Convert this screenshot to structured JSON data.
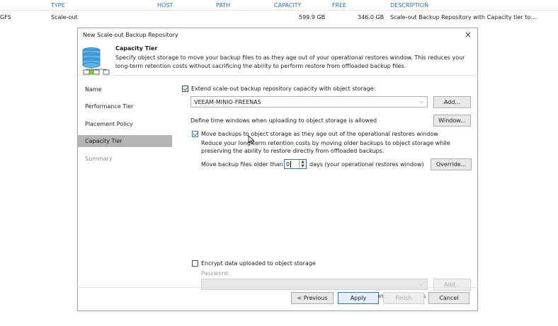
{
  "background_table": {
    "columns": [
      "TYPE",
      "HOST",
      "PATH",
      "CAPACITY",
      "FREE",
      "DESCRIPTION"
    ],
    "row": {
      "name": "GFS",
      "type": "Scale-out",
      "host": "",
      "path": "",
      "capacity": "599.9 GB",
      "free": "346.0 GB",
      "description": "Scale-out Backup Repository with Capacity tier to..."
    }
  },
  "dialog": {
    "title": "New Scale-out Backup Repository",
    "close_label": "×",
    "header": {
      "icon": "storage-repository-icon",
      "title": "Capacity Tier",
      "description": "Specify object storage to move your backup files to as they age out of your operational restores window. This reduces your long-term retention costs without sacrificing the ability to perform restore from offloaded backup files."
    },
    "steps": [
      {
        "label": "Name",
        "state": "normal"
      },
      {
        "label": "Performance Tier",
        "state": "normal"
      },
      {
        "label": "Placement Policy",
        "state": "normal"
      },
      {
        "label": "Capacity Tier",
        "state": "active"
      },
      {
        "label": "Summary",
        "state": "disabled"
      }
    ],
    "content": {
      "extend_label": "Extend scale-out backup repository capacity with object storage:",
      "extend_checked": true,
      "object_storage_value": "VEEAM-MINIO-FREENAS",
      "add_label": "Add...",
      "time_windows_label": "Define time windows when uploading to object storage is allowed",
      "window_label": "Window...",
      "move_label": "Move backups to object storage as they age out of the operational restores window",
      "move_checked": true,
      "move_desc_line1": "Reduce your long-term retention costs by moving older backups to object storage while",
      "move_desc_line2": "preserving the ability to restore directly from offloaded backups.",
      "older_than_label": "Move backup files older than",
      "older_than_value": "0",
      "days_label": "days (your operational restores window)",
      "override_label": "Override...",
      "encrypt_label": "Encrypt data uploaded to object storage",
      "encrypt_checked": false,
      "password_label": "Password:",
      "password_value": "",
      "add_password_label": "Add...",
      "manage_passwords_label": "Manage passwords"
    },
    "footer": {
      "previous_label": "< Previous",
      "apply_label": "Apply",
      "finish_label": "Finish",
      "cancel_label": "Cancel"
    }
  },
  "colors": {
    "active_step_bg": "#b4b4b4",
    "header_link": "#2b6cb0",
    "focus_blue": "#2f74c0"
  }
}
